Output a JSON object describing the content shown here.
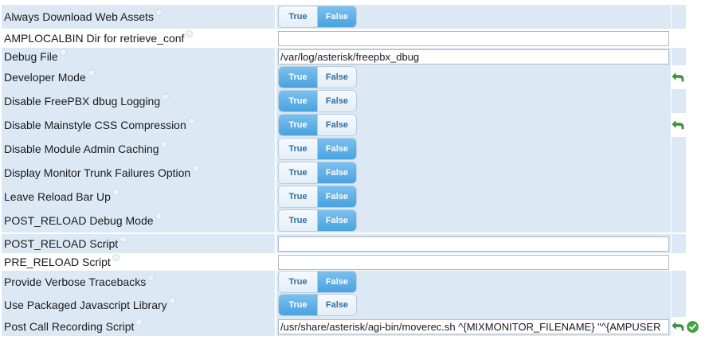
{
  "toggle_labels": {
    "true": "True",
    "false": "False"
  },
  "settings": [
    {
      "label": "Always Download Web Assets",
      "type": "toggle",
      "value": "False"
    },
    {
      "label": "AMPLOCALBIN Dir for retrieve_conf",
      "type": "text",
      "value": ""
    },
    {
      "label": "Debug File",
      "type": "text",
      "value": "/var/log/asterisk/freepbx_dbug"
    },
    {
      "label": "Developer Mode",
      "type": "toggle",
      "value": "True",
      "action_icon": "undo-icon"
    },
    {
      "label": "Disable FreePBX dbug Logging",
      "type": "toggle",
      "value": "True"
    },
    {
      "label": "Disable Mainstyle CSS Compression",
      "type": "toggle",
      "value": "True",
      "action_icon": "undo-icon"
    },
    {
      "label": "Disable Module Admin Caching",
      "type": "toggle",
      "value": "False"
    },
    {
      "label": "Display Monitor Trunk Failures Option",
      "type": "toggle",
      "value": "False"
    },
    {
      "label": "Leave Reload Bar Up",
      "type": "toggle",
      "value": "False"
    },
    {
      "label": "POST_RELOAD Debug Mode",
      "type": "toggle",
      "value": "False"
    },
    {
      "label": "POST_RELOAD Script",
      "type": "text",
      "value": ""
    },
    {
      "label": "PRE_RELOAD Script",
      "type": "text",
      "value": ""
    },
    {
      "label": "Provide Verbose Tracebacks",
      "type": "toggle",
      "value": "False"
    },
    {
      "label": "Use Packaged Javascript Library",
      "type": "toggle",
      "value": "True"
    },
    {
      "label": "Post Call Recording Script",
      "type": "text",
      "value": "/usr/share/asterisk/agi-bin/moverec.sh ^{MIXMONITOR_FILENAME} \"^{AMPUSER",
      "action_icon": "undo-icon",
      "confirm_icon": "check-icon"
    }
  ],
  "colors": {
    "row_shade": "#dce9f5",
    "toggle_active": "#49a2df",
    "undo_icon": "#3a9a3a",
    "check_icon": "#43a843"
  }
}
